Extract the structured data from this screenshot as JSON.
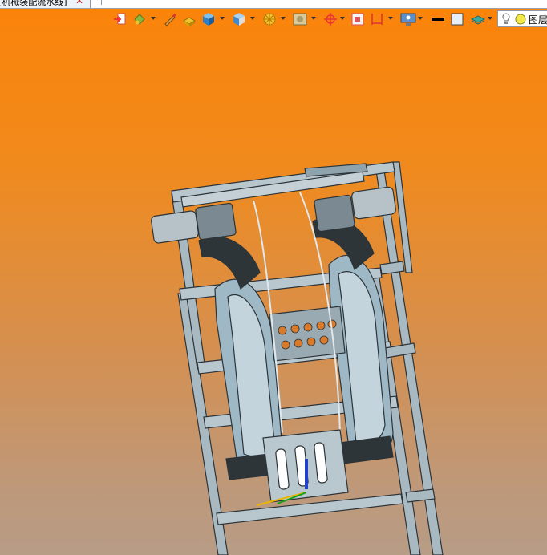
{
  "document_tab": {
    "title": "[机械装配流水线]",
    "close_symbol": "✕"
  },
  "toolbar": {
    "buttons": [
      {
        "name": "insert-part",
        "icon": "insert-icon"
      },
      {
        "name": "appearance",
        "icon": "paint-bucket-icon"
      },
      {
        "name": "sketch",
        "icon": "pencil-icon"
      },
      {
        "name": "extrude",
        "icon": "extrude-icon"
      },
      {
        "name": "view-cube",
        "icon": "cube-icon"
      },
      {
        "name": "display-style",
        "icon": "display-style-icon"
      },
      {
        "name": "section-view",
        "icon": "section-icon"
      },
      {
        "name": "render",
        "icon": "render-icon"
      },
      {
        "name": "reference-axis",
        "icon": "axis-icon"
      },
      {
        "name": "sketch-plane",
        "icon": "plane-icon"
      },
      {
        "name": "dimension",
        "icon": "dimension-icon"
      },
      {
        "name": "monitor",
        "icon": "monitor-icon"
      },
      {
        "name": "line-style",
        "icon": "line-icon"
      },
      {
        "name": "color-box",
        "icon": "color-box-icon"
      },
      {
        "name": "layers-style",
        "icon": "layers-icon"
      }
    ]
  },
  "layer_control": {
    "label": "图层"
  },
  "colors": {
    "accent": "#fb8309",
    "frame": "#8fa7b3",
    "frame_dark": "#2b3338",
    "belt": "#9eb7c4"
  }
}
